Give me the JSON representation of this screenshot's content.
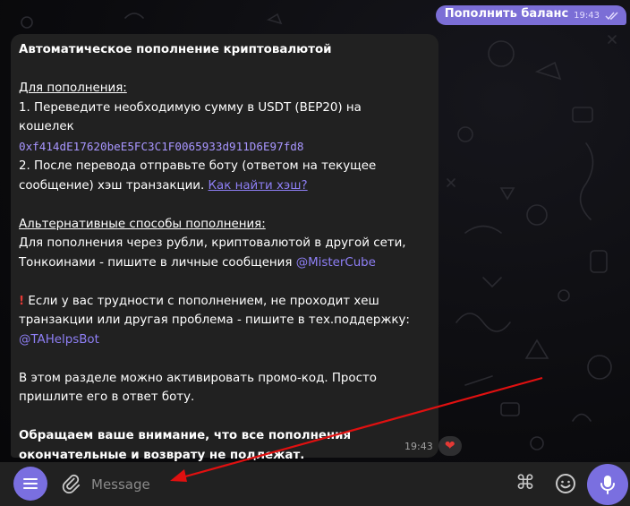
{
  "outgoing": {
    "text": "Пополнить баланс",
    "time": "19:43"
  },
  "message": {
    "title": "Автоматическое пополнение криптовалютой",
    "section1_heading": "Для пополнения:",
    "step1_a": "1. Переведите необходимую сумму в USDT (BEP20) на",
    "step1_b": "кошелек",
    "wallet": "0xf414dE17620beE5FC3C1F0065933d911D6E97fd8",
    "step2_a": "2. После перевода отправьте боту (ответом на текущее",
    "step2_b": "сообщение) хэш транзакции. ",
    "hash_link": "Как найти хэш?",
    "section2_heading": "Альтернативные способы пополнения:",
    "alt_a": "Для пополнения через рубли, криптовалютой в другой сети,",
    "alt_b": "Тонкоинами - пишите в личные сообщения ",
    "alt_mention": "@MisterCube",
    "warn_icon": "!",
    "warn_a": " Если у вас трудности с пополнением, не проходит хеш",
    "warn_b": "транзакции или другая проблема - пишите в тех.поддержку:",
    "support_mention": "@TAHelpsBot",
    "promo_a": "В этом разделе можно активировать промо-код. Просто",
    "promo_b": "пришлите его в ответ боту.",
    "final_a": "Обращаем ваше внимание, что все пополнения",
    "final_b": "окончательные и возврату не подлежат.",
    "time": "19:43",
    "reaction": "❤"
  },
  "composer": {
    "placeholder": "Message",
    "command_icon": "⌘"
  },
  "colors": {
    "accent": "#7a6fe0",
    "outgoing_bubble": "#7b6ed6",
    "incoming_bubble": "#212121",
    "annotation_arrow": "#e01010"
  }
}
